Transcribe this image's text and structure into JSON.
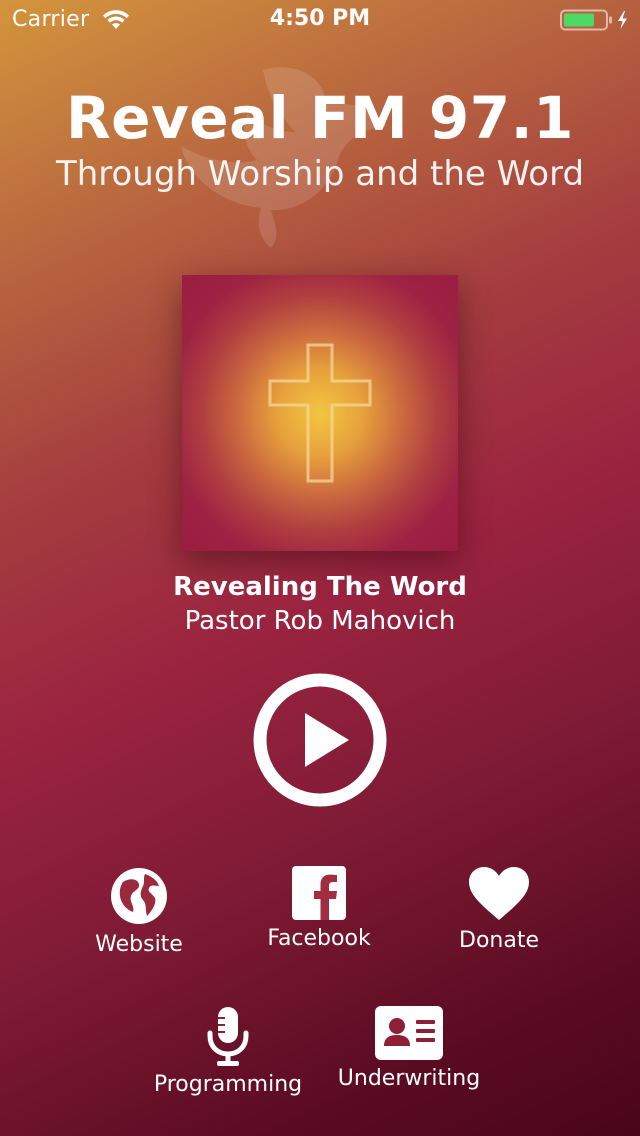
{
  "status_bar": {
    "carrier": "Carrier",
    "time": "4:50 PM",
    "battery_level": 0.75
  },
  "header": {
    "title": "Reveal FM 97.1",
    "tagline": "Through Worship and the Word"
  },
  "now_playing": {
    "show_title": "Revealing The Word",
    "host": "Pastor Rob Mahovich",
    "artwork_icon": "cross-icon"
  },
  "player": {
    "play_icon": "play-icon"
  },
  "links": {
    "website": {
      "label": "Website",
      "icon": "globe-icon"
    },
    "facebook": {
      "label": "Facebook",
      "icon": "facebook-icon"
    },
    "donate": {
      "label": "Donate",
      "icon": "heart-icon"
    },
    "programming": {
      "label": "Programming",
      "icon": "microphone-icon"
    },
    "underwriting": {
      "label": "Underwriting",
      "icon": "id-card-icon"
    }
  },
  "colors": {
    "gradient_top": "#d4953c",
    "gradient_mid": "#9b2440",
    "gradient_bottom": "#4a0519",
    "artwork_glow": "#f2c640",
    "artwork_base": "#9a1d42",
    "battery_fill": "#4cd964",
    "text": "#ffffff"
  }
}
